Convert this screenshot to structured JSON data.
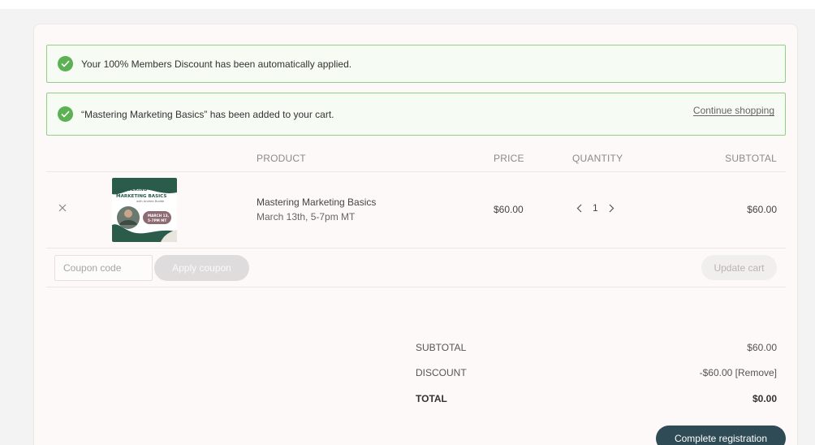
{
  "notices": {
    "discount": "Your 100% Members Discount has been automatically applied.",
    "added": "“Mastering Marketing Basics” has been added to your cart.",
    "continue_label": "Continue shopping"
  },
  "table": {
    "headers": {
      "product": "PRODUCT",
      "price": "PRICE",
      "quantity": "QUANTITY",
      "subtotal": "SUBTOTAL"
    }
  },
  "item": {
    "name": "Mastering Marketing Basics",
    "date": "March 13th, 5-7pm MT",
    "price": "$60.00",
    "quantity": "1",
    "subtotal": "$60.00",
    "thumbnail": {
      "title_line1": "MASTERING",
      "title_line2": "MARKETING BASICS",
      "byline": "with Andrea Budde",
      "badge_line1": "MARCH 13,",
      "badge_line2": "5-7PM MT"
    }
  },
  "coupon": {
    "placeholder": "Coupon code",
    "apply_label": "Apply coupon",
    "update_label": "Update cart"
  },
  "totals": {
    "subtotal_label": "SUBTOTAL",
    "subtotal_value": "$60.00",
    "discount_label": "DISCOUNT",
    "discount_value": "-$60.00 [Remove]",
    "total_label": "TOTAL",
    "total_value": "$0.00"
  },
  "checkout": {
    "complete_label": "Complete registration"
  },
  "colors": {
    "accent": "#2f4b55",
    "success": "#5bb154",
    "notice_border": "#8fcf86",
    "thumb_green": "#2b5b4a",
    "badge_mauve": "#8c6b73"
  }
}
